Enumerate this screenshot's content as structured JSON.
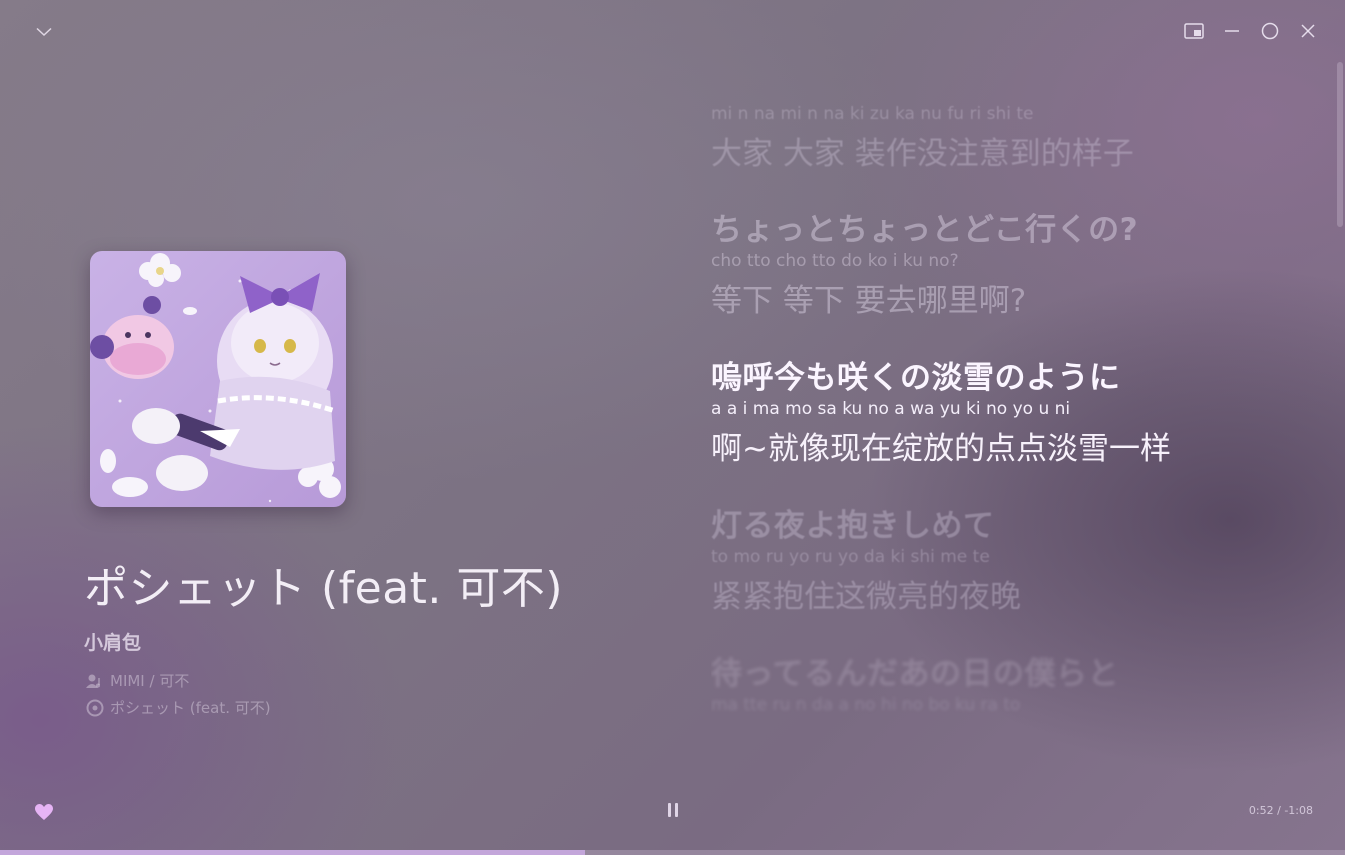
{
  "window": {
    "collapse_icon": "chevron-down-icon",
    "controls": [
      "mini-player-icon",
      "minimize-icon",
      "maximize-icon",
      "close-icon"
    ]
  },
  "track": {
    "title": "ポシェット (feat. 可不)",
    "subtitle": "小肩包",
    "artists": "MIMI / 可不",
    "album": "ポシェット (feat. 可不)"
  },
  "lyrics": [
    {
      "jp": "",
      "roma": "mi n na mi n na ki zu ka nu fu ri shi te",
      "cn": "大家 大家 装作没注意到的样子",
      "state": "dim"
    },
    {
      "jp": "ちょっとちょっとどこ行くの?",
      "roma": "cho tto cho tto do ko i ku no?",
      "cn": "等下 等下 要去哪里啊?",
      "state": "faded"
    },
    {
      "jp": "嗚呼今も咲くの淡雪のように",
      "roma": "a a i ma mo sa ku no a wa yu ki no yo u ni",
      "cn": "啊~就像现在绽放的点点淡雪一样",
      "state": "current"
    },
    {
      "jp": "灯る夜よ抱きしめて",
      "roma": "to mo ru yo ru yo da ki shi me te",
      "cn": "紧紧抱住这微亮的夜晚",
      "state": "dim"
    },
    {
      "jp": "待ってるんだあの日の僕らと",
      "roma": "ma tte ru n da a no hi no bo ku ra to",
      "cn": "",
      "state": "ghost"
    }
  ],
  "player": {
    "liked": true,
    "time": "0:52 / -1:08",
    "progress": 0.435
  },
  "colors": {
    "accent": "#c8aae1",
    "heart": "#e6b4f5"
  }
}
